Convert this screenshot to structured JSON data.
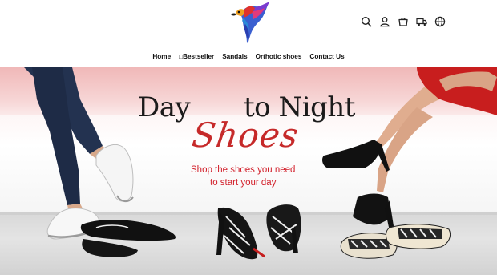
{
  "brand": {
    "logo_icon": "parrot-logo-icon",
    "colors": [
      "#e0322c",
      "#f0a020",
      "#3a6fd8",
      "#7a3bd0"
    ]
  },
  "header_icons": [
    {
      "name": "search-icon"
    },
    {
      "name": "account-icon"
    },
    {
      "name": "cart-icon"
    },
    {
      "name": "shipping-icon"
    },
    {
      "name": "globe-icon"
    }
  ],
  "nav": {
    "items": [
      {
        "label": "Home"
      },
      {
        "label": "□Bestseller"
      },
      {
        "label": "Sandals"
      },
      {
        "label": "Orthotic shoes"
      },
      {
        "label": "Contact Us"
      }
    ]
  },
  "hero": {
    "headline_part1": "Day",
    "headline_part2": "to Night",
    "script_text": "Shoes",
    "tagline_line1": "Shop the shoes you need",
    "tagline_line2": "to  start your day",
    "accent_color": "#c62a2a"
  }
}
